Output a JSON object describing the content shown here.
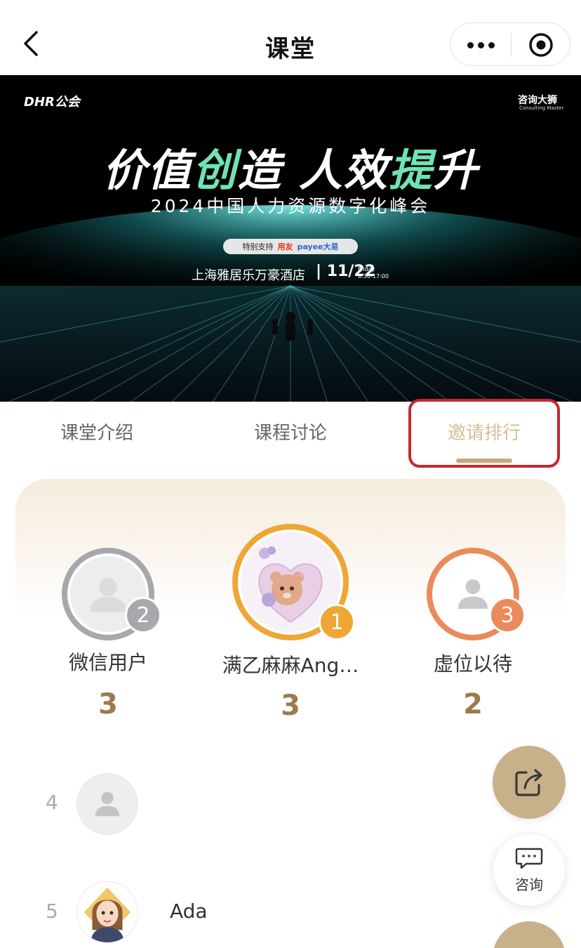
{
  "nav": {
    "title": "课堂"
  },
  "banner": {
    "logo_left": "DHR公会",
    "logo_right": "咨询大狮",
    "logo_right_sub": "Consulting Master",
    "headline_1": "价值",
    "headline_2": "创",
    "headline_3": "造 人效",
    "headline_4": "提",
    "headline_5": "升",
    "subtitle": "2024中国人力资源数字化峰会",
    "support_label": "特别支持",
    "sponsor_1": "用友",
    "sponsor_2": "payee大易",
    "venue": "上海雅居乐万豪酒店",
    "date": "| 11/22",
    "weekday": "Friday",
    "time": "8:30-17:00",
    "accent_color": "#6fe3b4"
  },
  "tabs": [
    {
      "label": "课堂介绍"
    },
    {
      "label": "课程讨论"
    },
    {
      "label": "邀请排行",
      "active": true
    }
  ],
  "podium": [
    {
      "rank": "2",
      "name": "微信用户",
      "count": "3",
      "ring_color": "#a7a7ad"
    },
    {
      "rank": "1",
      "name": "满乙麻麻Ang…",
      "count": "3",
      "ring_color": "#efa635"
    },
    {
      "rank": "3",
      "name": "虚位以待",
      "count": "2",
      "ring_color": "#eb8a5b"
    }
  ],
  "list": [
    {
      "rank": "4",
      "name": ""
    },
    {
      "rank": "5",
      "name": "Ada"
    }
  ],
  "fab": {
    "consult_label": "咨询"
  }
}
